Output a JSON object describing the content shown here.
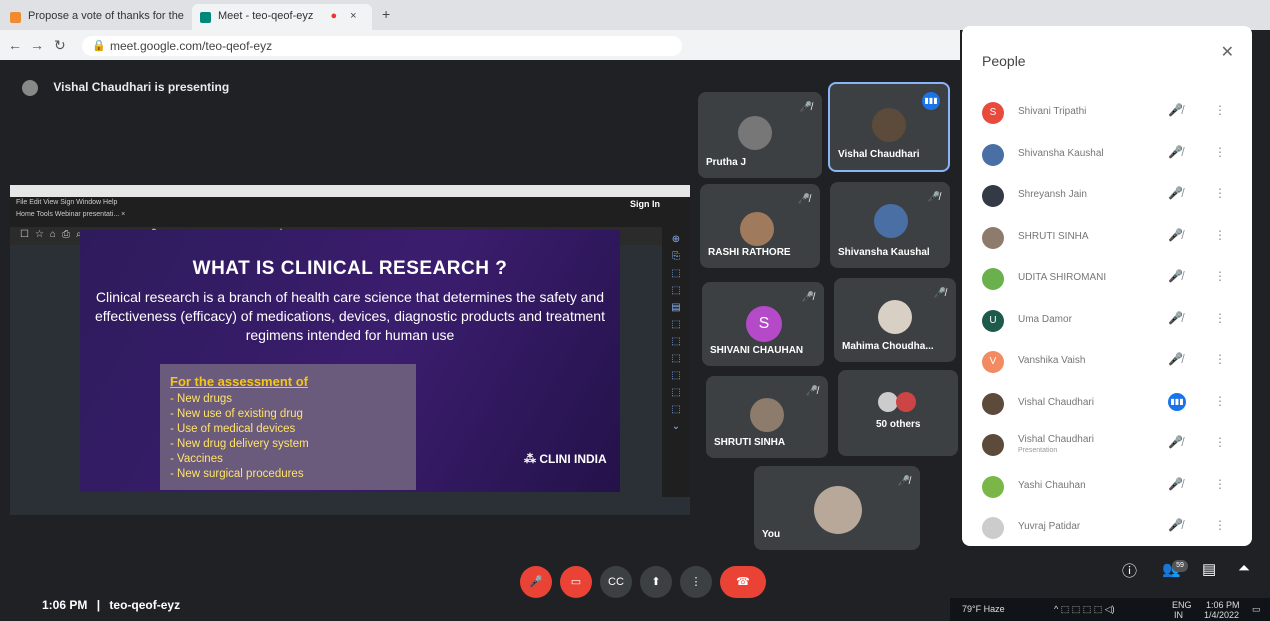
{
  "browser": {
    "tabs": [
      {
        "title": "Propose a vote of thanks for the",
        "close": "×"
      },
      {
        "title": "Meet - teo-qeof-eyz",
        "close": "×"
      },
      {
        "new_tab": "+"
      }
    ],
    "url": "meet.google.com/teo-qeof-eyz"
  },
  "meet": {
    "presenting_text": "Vishal Chaudhari is presenting",
    "meeting_time": "1:06 PM",
    "separator": "|",
    "meeting_code": "teo-qeof-eyz"
  },
  "presentation": {
    "pdf_menu": "File  Edit  View  Sign  Window  Help",
    "pdf_tabs": "Home    Tools         Webinar presentati...  ×",
    "sign_in": "Sign In",
    "slide_title": "WHAT IS CLINICAL RESEARCH ?",
    "slide_body": "Clinical research is a branch of health care science that determines the safety and effectiveness  (efficacy) of medications, devices, diagnostic products and treatment regimens intended for human use",
    "assessment_heading": "For the assessment of",
    "assessment_items": [
      "- New drugs",
      "- New use of existing drug",
      "- Use of medical devices",
      "- New drug delivery system",
      "- Vaccines",
      "- New surgical procedures"
    ],
    "logo_text": "CLINI INDIA"
  },
  "tiles": [
    {
      "name": "Prutha J"
    },
    {
      "name": "Vishal Chaudhari"
    },
    {
      "name": "RASHI RATHORE"
    },
    {
      "name": "Shivansha Kaushal"
    },
    {
      "name": "SHIVANI CHAUHAN",
      "initial": "S"
    },
    {
      "name": "Mahima Choudha..."
    },
    {
      "name": "SHRUTI SINHA"
    },
    {
      "name": "50 others"
    },
    {
      "name": "You"
    }
  ],
  "people_panel": {
    "title": "People",
    "count_badge": "59",
    "participants": [
      {
        "name": "Shivani Tripathi",
        "initial": "S",
        "color": "#e84b3c"
      },
      {
        "name": "Shivansha Kaushal",
        "initial": "",
        "color": "#4a6fa5"
      },
      {
        "name": "Shreyansh Jain",
        "initial": "",
        "color": "#333a45"
      },
      {
        "name": "SHRUTI SINHA",
        "initial": "",
        "color": "#8d7b6c"
      },
      {
        "name": "UDITA SHIROMANI",
        "initial": "",
        "color": "#6ab04c"
      },
      {
        "name": "Uma Damor",
        "initial": "U",
        "color": "#1e5a4c"
      },
      {
        "name": "Vanshika Vaish",
        "initial": "V",
        "color": "#f28b62"
      },
      {
        "name": "Vishal Chaudhari",
        "initial": "",
        "color": "#5c4a3a"
      },
      {
        "name": "Vishal Chaudhari",
        "subtitle": "Presentation",
        "initial": "",
        "color": "#5c4a3a"
      },
      {
        "name": "Yashi Chauhan",
        "initial": "",
        "color": "#7ab648"
      },
      {
        "name": "Yuvraj Patidar",
        "initial": "",
        "color": "#cccccc"
      }
    ]
  },
  "taskbar": {
    "weather": "79°F  Haze",
    "lang": "ENG",
    "region": "IN",
    "time": "1:06 PM",
    "date": "1/4/2022"
  },
  "colors": {
    "meet_bg": "#202124",
    "tile_bg": "#3c4043",
    "end_call": "#ea4335",
    "speaking": "#1a73e8"
  }
}
